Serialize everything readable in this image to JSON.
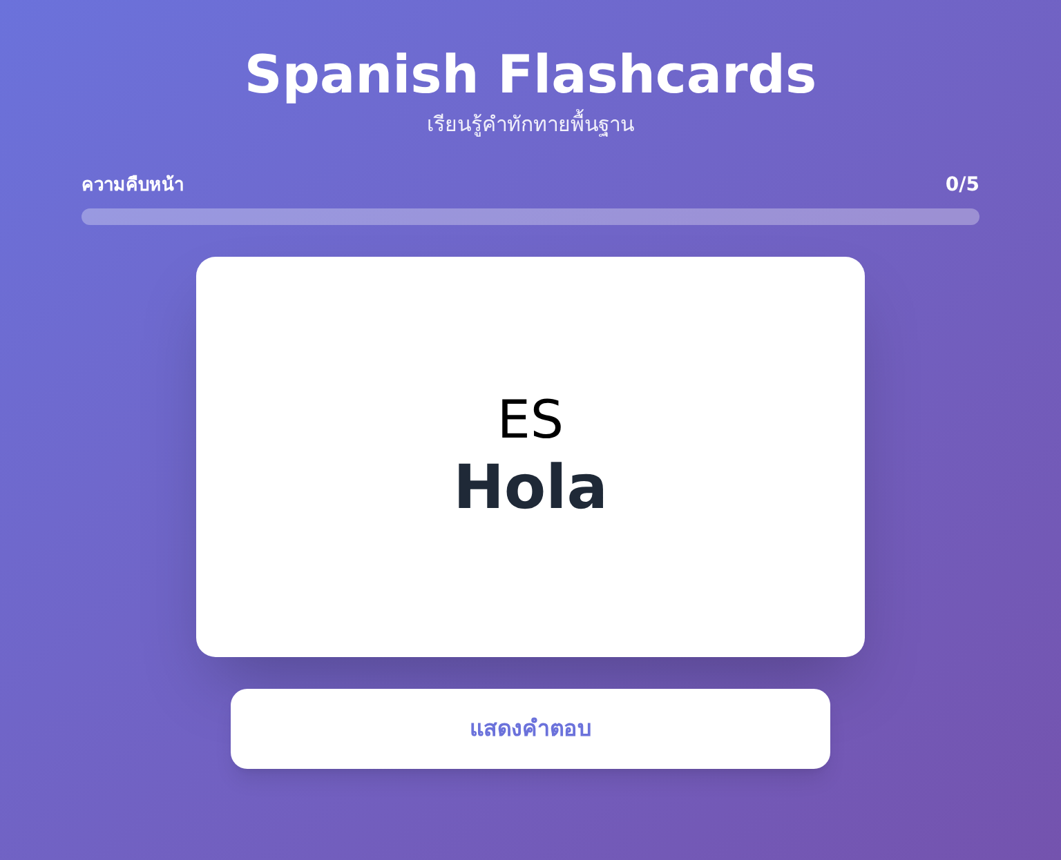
{
  "header": {
    "title": "Spanish Flashcards",
    "subtitle": "เรียนรู้คำทักทายพื้นฐาน"
  },
  "progress": {
    "label": "ความคืบหน้า",
    "count": "0/5",
    "level": 0
  },
  "card": {
    "language": "ES",
    "word": "Hola"
  },
  "button": {
    "label": "แสดงคำตอบ"
  }
}
